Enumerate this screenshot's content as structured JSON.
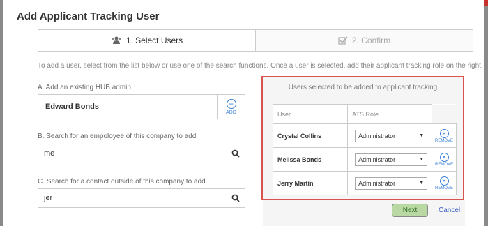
{
  "modal": {
    "title": "Add Applicant Tracking User"
  },
  "steps": [
    {
      "label": "1. Select Users",
      "icon": "users-icon",
      "active": true
    },
    {
      "label": "2. Confirm",
      "icon": "checkbox-icon",
      "active": false
    }
  ],
  "instructions": "To add a user, select from the list below or use one of the search functions.  Once a user is selected, add their applicant tracking role on the right.",
  "sectionA": {
    "label": "A. Add an existing HUB admin",
    "value": "Edward Bonds",
    "add_label": "ADD",
    "add_icon": "plus-icon"
  },
  "sectionB": {
    "label": "B. Search for an empoloyee of this company to add",
    "value": "me"
  },
  "sectionC": {
    "label": "C. Search for a contact outside of this company to add",
    "value": "jer"
  },
  "selected": {
    "title": "Users selected to be added to applicant tracking",
    "col_user": "User",
    "col_role": "ATS Role",
    "remove_label": "REMOVE",
    "rows": [
      {
        "name": "Crystal Collins",
        "role": "Administrator"
      },
      {
        "name": "Melissa Bonds",
        "role": "Administrator"
      },
      {
        "name": "Jerry Martin",
        "role": "Administrator"
      }
    ]
  },
  "actions": {
    "next": "Next",
    "cancel": "Cancel"
  },
  "colors": {
    "highlight_border": "#d9534f",
    "link": "#3a7fd5",
    "next_bg": "#b9d8a4"
  }
}
